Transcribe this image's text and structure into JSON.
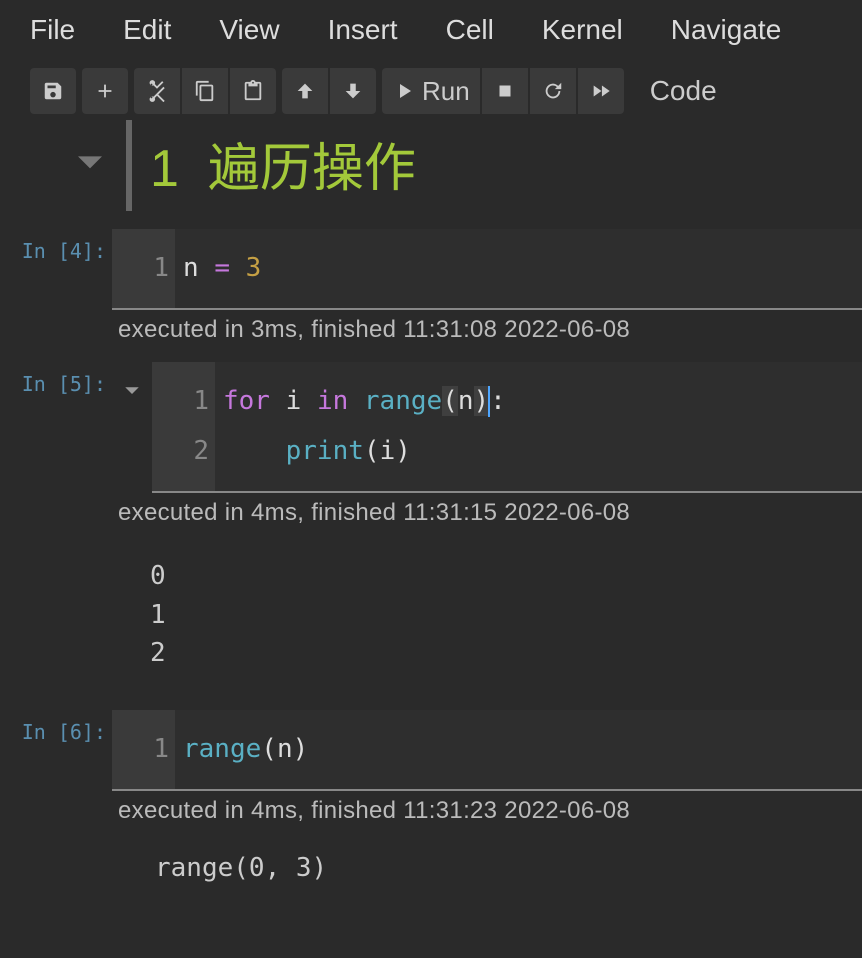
{
  "menu": {
    "file": "File",
    "edit": "Edit",
    "view": "View",
    "insert": "Insert",
    "cell": "Cell",
    "kernel": "Kernel",
    "navigate": "Navigate"
  },
  "toolbar": {
    "run": "Run",
    "celltype": "Code"
  },
  "heading": {
    "number": "1",
    "title": "遍历操作"
  },
  "cells": [
    {
      "prompt": "In [4]:",
      "lines": [
        "1"
      ],
      "code_html": "<span class='var'>n</span> <span class='op'>=</span> <span class='num'>3</span>",
      "exec": "executed in 3ms, finished 11:31:08 2022-06-08",
      "output": ""
    },
    {
      "prompt": "In [5]:",
      "fold": true,
      "lines": [
        "1",
        "2"
      ],
      "code_html": "<span class='kw'>for</span> <span class='var'>i</span> <span class='kw'>in</span> <span class='fn'>range</span><span class='par hlpar'>(</span><span class='var'>n</span><span class='par hlpar'>)</span><span class='cursor'></span>:\n    <span class='fn'>print</span><span class='par'>(</span><span class='var'>i</span><span class='par'>)</span>",
      "exec": "executed in 4ms, finished 11:31:15 2022-06-08",
      "output": "0\n1\n2"
    },
    {
      "prompt": "In [6]:",
      "lines": [
        "1"
      ],
      "code_html": "<span class='fn'>range</span><span class='par'>(</span><span class='var'>n</span><span class='par'>)</span>",
      "exec": "executed in 4ms, finished 11:31:23 2022-06-08",
      "output": "range(0, 3)"
    }
  ]
}
